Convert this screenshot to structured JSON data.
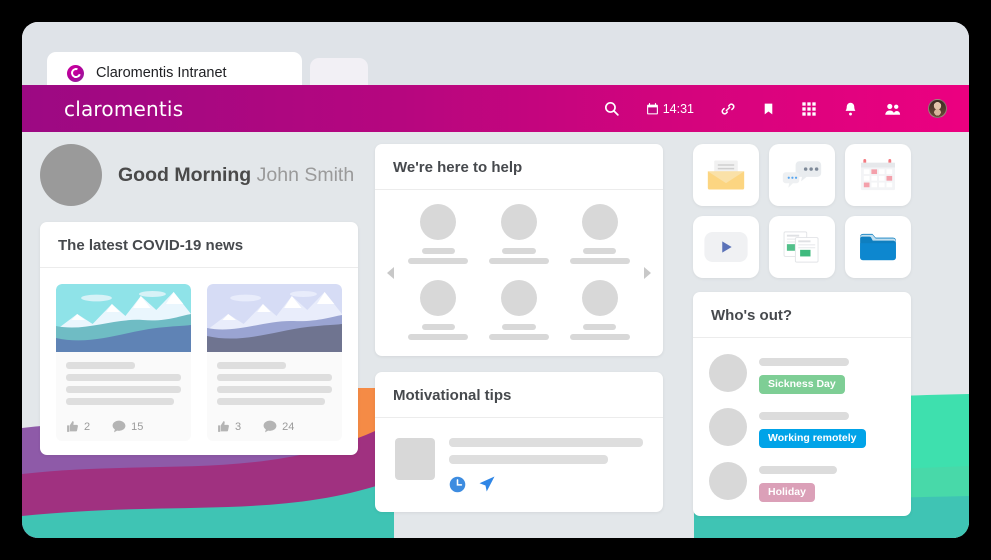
{
  "browser": {
    "tab_title": "Claromentis Intranet",
    "favicon": "claromentis-c-icon"
  },
  "navbar": {
    "brand": "claromentis",
    "time": "14:31",
    "gradient_from": "#9c0983",
    "gradient_to": "#ec0080",
    "icons": [
      {
        "name": "search-icon",
        "glyph": "search"
      },
      {
        "name": "calendar-clock-icon",
        "glyph": "calendar"
      },
      {
        "name": "link-icon",
        "glyph": "link"
      },
      {
        "name": "bookmark-icon",
        "glyph": "bookmark"
      },
      {
        "name": "apps-grid-icon",
        "glyph": "grid"
      },
      {
        "name": "notifications-bell-icon",
        "glyph": "bell"
      },
      {
        "name": "people-icon",
        "glyph": "people"
      },
      {
        "name": "user-avatar",
        "glyph": "avatar"
      }
    ]
  },
  "greeting": {
    "salutation": "Good Morning",
    "name": "John Smith"
  },
  "news": {
    "title": "The latest COVID-19 news",
    "items": [
      {
        "likes": "2",
        "comments": "15",
        "image": "mountain-cyan"
      },
      {
        "likes": "3",
        "comments": "24",
        "image": "mountain-lavender"
      }
    ]
  },
  "help": {
    "title": "We're here to help",
    "people_count": 6,
    "prev_label": "previous",
    "next_label": "next"
  },
  "tips": {
    "title": "Motivational tips",
    "icons": [
      {
        "name": "clock-icon",
        "color": "#3d8ce0"
      },
      {
        "name": "send-icon",
        "color": "#3d8ce0"
      }
    ]
  },
  "apps": {
    "tiles": [
      {
        "name": "email-tile",
        "icon": "envelope-icon"
      },
      {
        "name": "chat-tile",
        "icon": "chat-bubbles-icon"
      },
      {
        "name": "calendar-tile",
        "icon": "calendar-icon"
      },
      {
        "name": "video-tile",
        "icon": "play-icon"
      },
      {
        "name": "spreadsheet-tile",
        "icon": "documents-icon"
      },
      {
        "name": "files-tile",
        "icon": "folder-icon"
      }
    ]
  },
  "whos_out": {
    "title": "Who's out?",
    "rows": [
      {
        "status": "Sickness Day",
        "color": "#7ece95",
        "line_width": 90
      },
      {
        "status": "Working remotely",
        "color": "#00a3e8",
        "line_width": 90
      },
      {
        "status": "Holiday",
        "color": "#dba0b8",
        "line_width": 78
      }
    ]
  },
  "decoration": {
    "colors": [
      "#8e5aa8",
      "#a03180",
      "#f58b46",
      "#3ee0ae",
      "#3fc4b4"
    ]
  }
}
